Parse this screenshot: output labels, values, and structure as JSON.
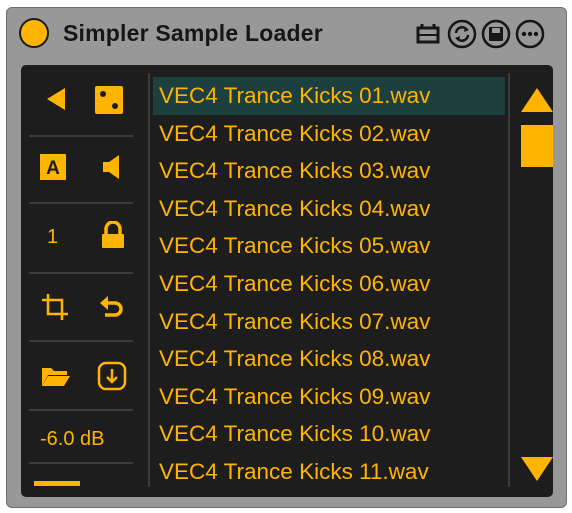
{
  "window": {
    "title": "Simpler Sample Loader",
    "accent_color": "#ffb400",
    "title_icons": [
      "clip-icon",
      "swap-icon",
      "save-icon",
      "more-icon"
    ]
  },
  "controls": {
    "transpose_value": "1",
    "gain": "-6.0 dB",
    "icons": [
      "play-left-icon",
      "dice-icon",
      "auto-icon",
      "speaker-icon",
      "lock-icon",
      "crop-icon",
      "undo-icon",
      "folder-icon",
      "download-icon"
    ]
  },
  "file_list": {
    "selected_index": 0,
    "items": [
      "VEC4 Trance Kicks 01.wav",
      "VEC4 Trance Kicks 02.wav",
      "VEC4 Trance Kicks 03.wav",
      "VEC4 Trance Kicks 04.wav",
      "VEC4 Trance Kicks 05.wav",
      "VEC4 Trance Kicks 06.wav",
      "VEC4 Trance Kicks 07.wav",
      "VEC4 Trance Kicks 08.wav",
      "VEC4 Trance Kicks 09.wav",
      "VEC4 Trance Kicks 10.wav",
      "VEC4 Trance Kicks 11.wav"
    ]
  },
  "scrollbar": {
    "up_icon": "arrow-up-icon",
    "down_icon": "arrow-down-icon"
  }
}
